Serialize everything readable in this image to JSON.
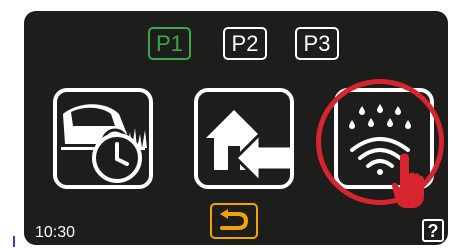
{
  "profiles": [
    {
      "label": "P1",
      "active": true
    },
    {
      "label": "P2",
      "active": false
    },
    {
      "label": "P3",
      "active": false
    }
  ],
  "tiles": [
    {
      "icon": "mower-schedule-icon"
    },
    {
      "icon": "home-return-icon"
    },
    {
      "icon": "rain-sensor-icon"
    }
  ],
  "status": {
    "time": "10:30"
  },
  "help": {
    "label": "?"
  },
  "back": {
    "icon": "back-arrow-icon"
  },
  "colors": {
    "accent_green": "#3aa84a",
    "back_orange": "#f2a300",
    "highlight_red": "#d6252f",
    "screen_bg": "#1d1d1b"
  },
  "annotation": {
    "icon": "pointing-hand-icon"
  }
}
